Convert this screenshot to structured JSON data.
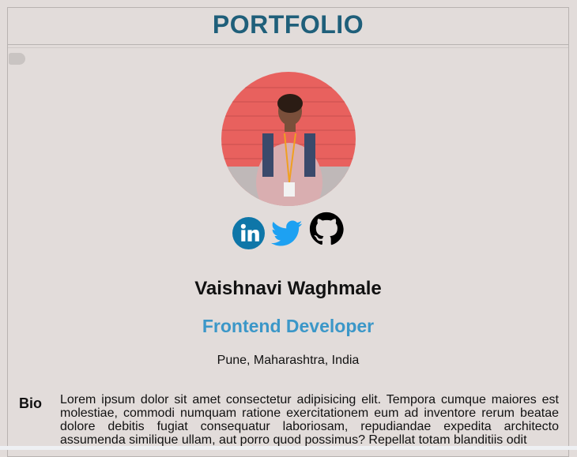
{
  "header": {
    "title": "PORTFOLIO"
  },
  "profile": {
    "name": "Vaishnavi Waghmale",
    "role": "Frontend Developer",
    "location": "Pune, Maharashtra, India",
    "photo_icon": "profile-photo"
  },
  "social": [
    {
      "icon": "linkedin-icon",
      "color": "#0e76a8"
    },
    {
      "icon": "twitter-icon",
      "color": "#1da1f2"
    },
    {
      "icon": "github-icon",
      "color": "#000000"
    }
  ],
  "bio": {
    "label": "Bio",
    "text": "Lorem ipsum dolor sit amet consectetur adipisicing elit. Tempora cumque maiores est molestiae, commodi numquam ratione exercitationem eum ad inventore rerum beatae dolore debitis fugiat consequatur laboriosam, repudiandae expedita architecto assumenda similique ullam, aut porro quod possimus? Repellat totam blanditiis odit"
  },
  "colors": {
    "background": "#e2dcda",
    "title": "#1f5f7a",
    "accent": "#3b97c8"
  }
}
